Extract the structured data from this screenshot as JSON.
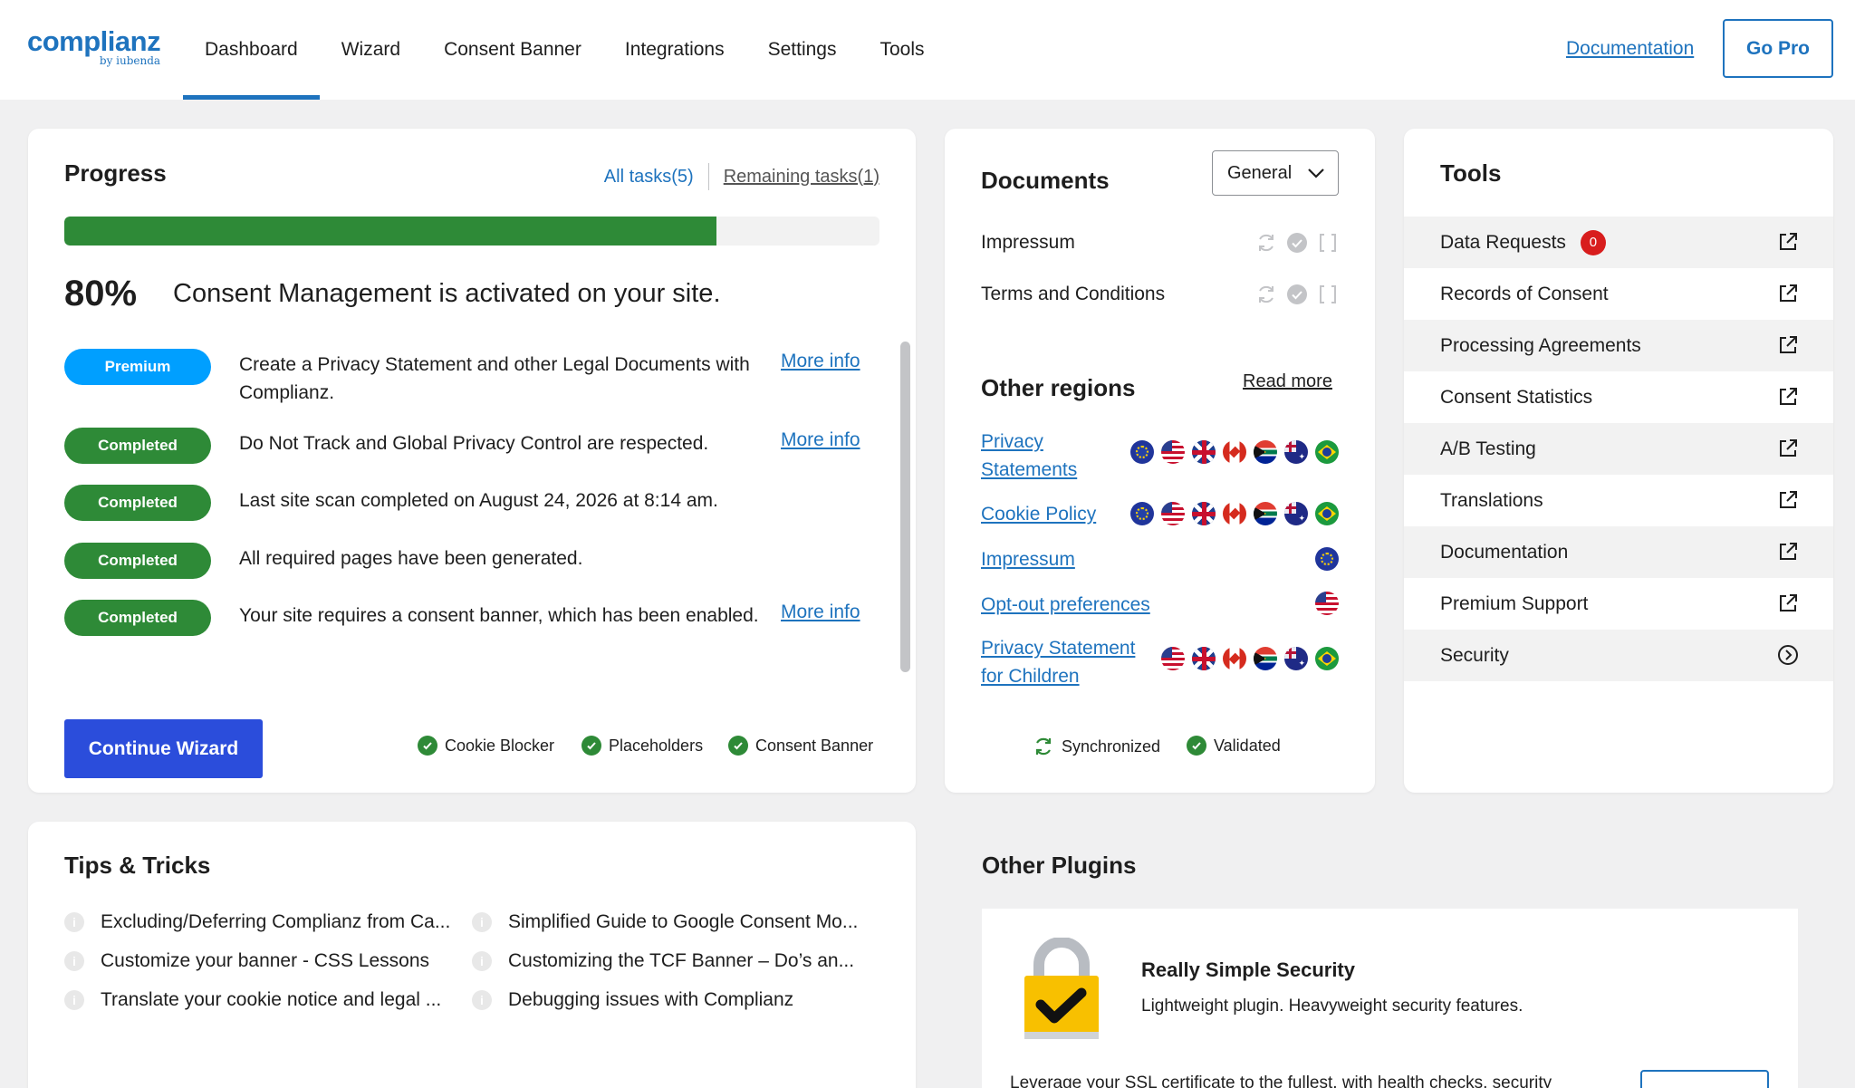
{
  "header": {
    "logo_main": "complianz",
    "logo_sub": "by iubenda",
    "nav": [
      "Dashboard",
      "Wizard",
      "Consent Banner",
      "Integrations",
      "Settings",
      "Tools"
    ],
    "active_nav": "Dashboard",
    "documentation_link": "Documentation",
    "go_pro": "Go Pro",
    "accent_color": "#1e73be"
  },
  "progress": {
    "title": "Progress",
    "all_tasks": "All tasks(5)",
    "remaining_tasks": "Remaining tasks(1)",
    "percent": 80,
    "percent_label": "80%",
    "status_text": "Consent Management is activated on your site.",
    "tasks": [
      {
        "badge": "Premium",
        "type": "premium",
        "text": "Create a Privacy Statement and other Legal Documents with Complianz.",
        "more": "More info"
      },
      {
        "badge": "Completed",
        "type": "completed",
        "text": "Do Not Track and Global Privacy Control are respected.",
        "more": "More info"
      },
      {
        "badge": "Completed",
        "type": "completed",
        "text": "Last site scan completed on August 24, 2026 at 8:14 am.",
        "more": ""
      },
      {
        "badge": "Completed",
        "type": "completed",
        "text": "All required pages have been generated.",
        "more": ""
      },
      {
        "badge": "Completed",
        "type": "completed",
        "text": "Your site requires a consent banner, which has been enabled.",
        "more": "More info"
      }
    ],
    "continue_button": "Continue Wizard",
    "features": [
      "Cookie Blocker",
      "Placeholders",
      "Consent Banner"
    ],
    "colors": {
      "bar": "#2e8a37",
      "premium": "#009fff",
      "button": "#2b4ddb"
    }
  },
  "documents": {
    "title": "Documents",
    "select_value": "General",
    "docs": [
      "Impressum",
      "Terms and Conditions"
    ],
    "other_regions_title": "Other regions",
    "read_more": "Read more",
    "regions": [
      {
        "label": "Privacy Statements",
        "flags": [
          "eu",
          "us",
          "uk",
          "ca",
          "za",
          "au",
          "br"
        ]
      },
      {
        "label": "Cookie Policy",
        "flags": [
          "eu",
          "us",
          "uk",
          "ca",
          "za",
          "au",
          "br"
        ]
      },
      {
        "label": "Impressum",
        "flags": [
          "eu"
        ]
      },
      {
        "label": "Opt-out preferences",
        "flags": [
          "us"
        ]
      },
      {
        "label": "Privacy Statement for Children",
        "flags": [
          "us",
          "uk",
          "ca",
          "za",
          "au",
          "br"
        ]
      }
    ],
    "status": [
      "Synchronized",
      "Validated"
    ]
  },
  "tools": {
    "title": "Tools",
    "items": [
      {
        "label": "Data Requests",
        "badge": "0",
        "icon": "external-link-icon"
      },
      {
        "label": "Records of Consent",
        "icon": "external-link-icon"
      },
      {
        "label": "Processing Agreements",
        "icon": "external-link-icon"
      },
      {
        "label": "Consent Statistics",
        "icon": "external-link-icon"
      },
      {
        "label": "A/B Testing",
        "icon": "external-link-icon"
      },
      {
        "label": "Translations",
        "icon": "external-link-icon"
      },
      {
        "label": "Documentation",
        "icon": "external-link-icon"
      },
      {
        "label": "Premium Support",
        "icon": "external-link-icon"
      },
      {
        "label": "Security",
        "icon": "chevron-circle-icon"
      }
    ]
  },
  "tips": {
    "title": "Tips & Tricks",
    "items": [
      "Excluding/Deferring Complianz from Ca...",
      "Simplified Guide to Google Consent Mo...",
      "Customize your banner - CSS Lessons",
      "Customizing the TCF Banner – Do’s an...",
      "Translate your cookie notice and legal ...",
      "Debugging issues with Complianz"
    ]
  },
  "plugins": {
    "title": "Other Plugins",
    "name": "Really Simple Security",
    "description": "Lightweight plugin. Heavyweight security features.",
    "long_text": "Leverage your SSL certificate to the fullest, with health checks, security"
  }
}
